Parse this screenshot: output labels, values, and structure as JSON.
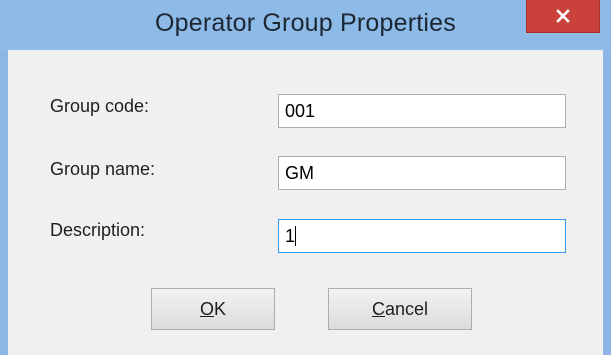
{
  "window": {
    "title": "Operator Group Properties",
    "close_icon": "close-icon"
  },
  "form": {
    "group_code": {
      "label": "Group code:",
      "value": "001"
    },
    "group_name": {
      "label": "Group name:",
      "value": "GM"
    },
    "description": {
      "label": "Description:",
      "value": "1"
    }
  },
  "buttons": {
    "ok": {
      "mnemonic": "O",
      "rest": "K"
    },
    "cancel": {
      "mnemonic": "C",
      "rest": "ancel"
    }
  },
  "colors": {
    "titlebar": "#8ebae8",
    "close_button": "#c9413a",
    "client_background": "#f0f0f0",
    "focus_border": "#3399ff"
  }
}
